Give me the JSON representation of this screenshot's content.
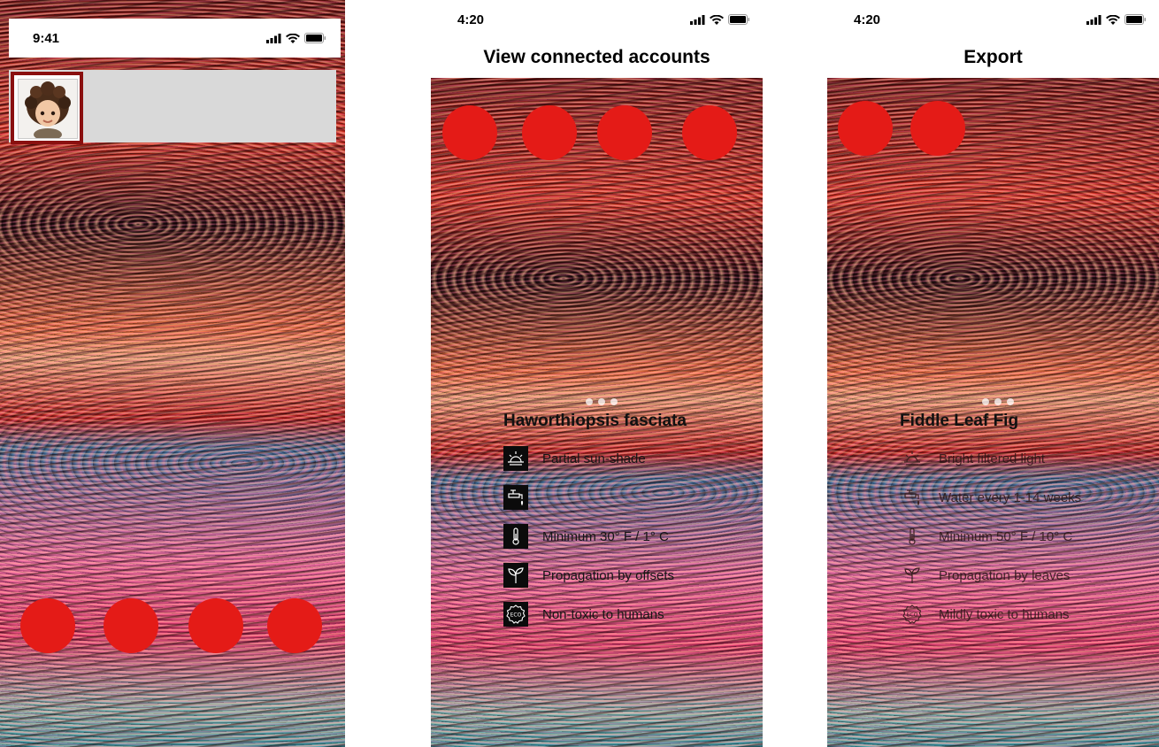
{
  "phone1": {
    "status_time": "9:41"
  },
  "phone2": {
    "status_time": "4:20",
    "title": "View connected accounts",
    "plant": {
      "name": "Haworthiopsis fasciata",
      "facts": [
        {
          "icon": "sun-icon",
          "text": "Partial sun-shade"
        },
        {
          "icon": "faucet-icon",
          "text": ""
        },
        {
          "icon": "thermometer-icon",
          "text": "Minimum 30° F / 1° C"
        },
        {
          "icon": "sprout-icon",
          "text": "Propagation by offsets"
        },
        {
          "icon": "eco-badge-icon",
          "text": "Non-toxic to humans"
        }
      ]
    }
  },
  "phone3": {
    "status_time": "4:20",
    "title": "Export",
    "plant": {
      "name": "Fiddle Leaf Fig",
      "facts": [
        {
          "icon": "sun-icon",
          "text": "Bright filtered light"
        },
        {
          "icon": "faucet-icon",
          "text": "Water every 1-14 weeks"
        },
        {
          "icon": "thermometer-icon",
          "text": "Minimum 50° F / 10° C"
        },
        {
          "icon": "sprout-icon",
          "text": "Propagation by leaves"
        },
        {
          "icon": "eco-badge-icon",
          "text": "Mildly toxic to humans"
        }
      ]
    }
  },
  "colors": {
    "accent_red": "#e41b17",
    "avatar_frame": "#8a1010",
    "card_gray": "#d9d9d9"
  }
}
